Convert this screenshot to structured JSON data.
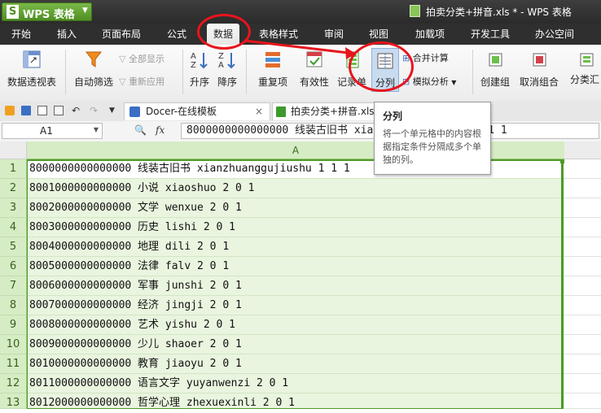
{
  "app": {
    "name": "WPS 表格",
    "logo": "S",
    "window_title": "拍卖分类+拼音.xls * - WPS 表格"
  },
  "menu": [
    "开始",
    "插入",
    "页面布局",
    "公式",
    "数据",
    "表格样式",
    "审阅",
    "视图",
    "加载项",
    "开发工具",
    "办公空间"
  ],
  "ribbon": {
    "pivot": "数据透视表",
    "autofilter": "自动筛选",
    "show_all": "全部显示",
    "reapply": "重新应用",
    "sort_asc": "升序",
    "sort_desc": "降序",
    "duplicates": "重复项",
    "validity": "有效性",
    "record": "记录单",
    "split": "分列",
    "merge_calc": "合并计算",
    "simulate": "模拟分析",
    "group": "创建组",
    "ungroup": "取消组合",
    "subtotal": "分类汇"
  },
  "tabs": [
    {
      "label": "Docer-在线模板",
      "close": "×"
    },
    {
      "label": "拍卖分类+拼音.xls"
    }
  ],
  "formula": {
    "cell_ref": "A1",
    "fx": "fx",
    "content": "8000000000000000 线装古旧书 xianzhuanggujiushu 1 1 1"
  },
  "tooltip": {
    "title": "分列",
    "description": "将一个单元格中的内容根据指定条件分隔成多个单独的列。"
  },
  "grid": {
    "column": "A",
    "rows": [
      {
        "num": "1",
        "text": "8000000000000000 线装古旧书 xianzhuanggujiushu 1 1 1"
      },
      {
        "num": "2",
        "text": "8001000000000000 小说 xiaoshuo 2 0 1"
      },
      {
        "num": "3",
        "text": "8002000000000000 文学 wenxue 2 0 1"
      },
      {
        "num": "4",
        "text": "8003000000000000 历史 lishi 2 0 1"
      },
      {
        "num": "5",
        "text": "8004000000000000 地理 dili 2 0 1"
      },
      {
        "num": "6",
        "text": "8005000000000000 法律 falv 2 0 1"
      },
      {
        "num": "7",
        "text": "8006000000000000 军事 junshi 2 0 1"
      },
      {
        "num": "8",
        "text": "8007000000000000 经济 jingji 2 0 1"
      },
      {
        "num": "9",
        "text": "8008000000000000 艺术 yishu 2 0 1"
      },
      {
        "num": "10",
        "text": "8009000000000000 少儿 shaoer 2 0 1"
      },
      {
        "num": "11",
        "text": "8010000000000000 教育 jiaoyu 2 0 1"
      },
      {
        "num": "12",
        "text": "8011000000000000 语言文字 yuyanwenzi 2 0 1"
      },
      {
        "num": "13",
        "text": "8012000000000000 哲学心理 zhexuexinli 2 0 1"
      }
    ]
  },
  "colors": {
    "accent_green": "#4f8f23",
    "annotation_red": "#e8141c",
    "selection_fill": "#e9f5df"
  }
}
